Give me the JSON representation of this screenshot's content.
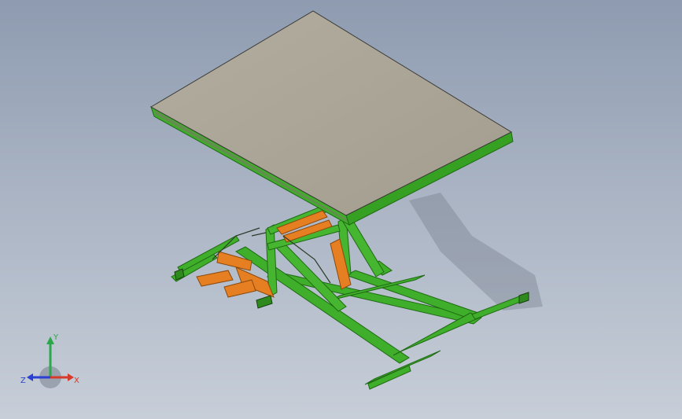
{
  "viewport": {
    "background_top": "#8e9bb0",
    "background_bottom": "#c7ced8"
  },
  "model": {
    "tabletop_color": "#aaa497",
    "frame_color": "#3fae2a",
    "cylinder_color": "#e67e22"
  },
  "triad": {
    "x_label": "X",
    "y_label": "Y",
    "z_label": "Z",
    "x_color": "#d63a2a",
    "y_color": "#2aa84a",
    "z_color": "#2a3fd6"
  }
}
